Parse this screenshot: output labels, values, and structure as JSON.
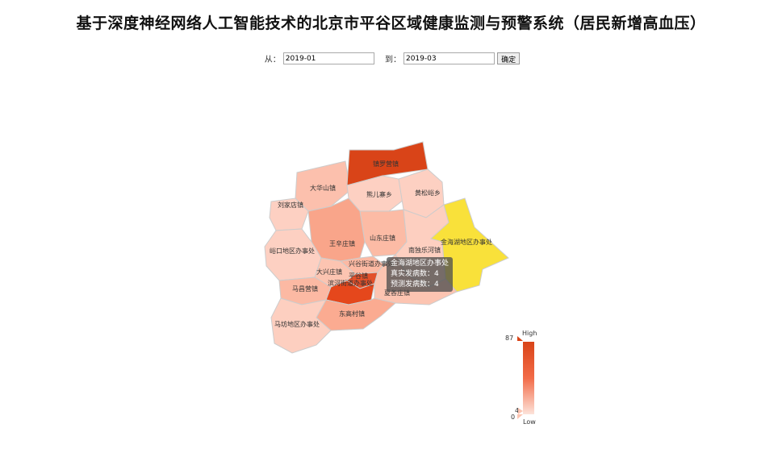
{
  "title": "基于深度神经网络人工智能技术的北京市平谷区域健康监测与预警系统（居民新增高血压）",
  "filter": {
    "from_label": "从：",
    "from_value": "2019-01",
    "to_label": "到：",
    "to_value": "2019-03",
    "confirm_label": "确定"
  },
  "regions": [
    {
      "id": "zhenluoying",
      "name": "镇罗营镇",
      "value": 87,
      "color": "#d94418"
    },
    {
      "id": "dahuashan",
      "name": "大华山镇",
      "value": 18,
      "color": "#fcc0ad"
    },
    {
      "id": "xiongeraizhai",
      "name": "熊儿寨乡",
      "value": 12,
      "color": "#fdd0c2"
    },
    {
      "id": "huangsongyu",
      "name": "黄松峪乡",
      "value": 12,
      "color": "#fdd0c2"
    },
    {
      "id": "liujiadian",
      "name": "刘家店镇",
      "value": 14,
      "color": "#fdd0c2"
    },
    {
      "id": "shandongzhuang",
      "name": "山东庄镇",
      "value": 20,
      "color": "#fcbba5"
    },
    {
      "id": "wangxinzhuang",
      "name": "王辛庄镇",
      "value": 40,
      "color": "#f9a58a"
    },
    {
      "id": "nandulehe",
      "name": "南独乐河镇",
      "value": 14,
      "color": "#fdcfc0"
    },
    {
      "id": "jinhaihu",
      "name": "金海湖地区办事处",
      "value": 4,
      "color": "#f9e13a"
    },
    {
      "id": "yukou",
      "name": "峪口地区办事处",
      "value": 14,
      "color": "#fdd0c2"
    },
    {
      "id": "xingu",
      "name": "兴谷街道办事处",
      "value": 22,
      "color": "#fcb9a3"
    },
    {
      "id": "daxingzhuang",
      "name": "大兴庄镇",
      "value": 16,
      "color": "#fcc4b1"
    },
    {
      "id": "pinggu",
      "name": "平谷镇",
      "value": 75,
      "color": "#e2502a"
    },
    {
      "id": "binhe",
      "name": "滨河街道办事处",
      "value": 80,
      "color": "#e5471c"
    },
    {
      "id": "xiagezhuang",
      "name": "夏各庄镇",
      "value": 18,
      "color": "#fcc4b1"
    },
    {
      "id": "machangying",
      "name": "马昌营镇",
      "value": 22,
      "color": "#fcb9a3"
    },
    {
      "id": "dongaocun",
      "name": "东高村镇",
      "value": 28,
      "color": "#fbab91"
    },
    {
      "id": "mafang",
      "name": "马坊地区办事处",
      "value": 14,
      "color": "#fdcfc0"
    }
  ],
  "tooltip": {
    "title": "金海湖地区办事处",
    "line1": "真实发病数：4",
    "line2": "预测发病数：4"
  },
  "visual_map": {
    "max": 87,
    "min": 0,
    "high_label": "High",
    "low_label": "Low",
    "indicator_value": 4,
    "high_color": "#d94418",
    "low_color": "#fde3da"
  }
}
